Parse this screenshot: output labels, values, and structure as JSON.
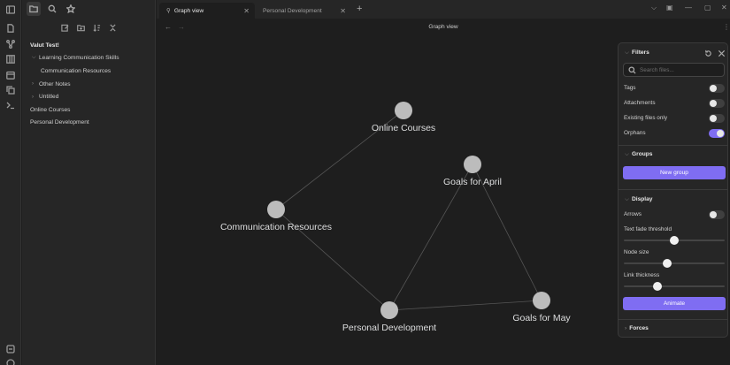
{
  "sidebar": {
    "vault_name": "Valut Test!",
    "tree": [
      {
        "label": "Learning Communication Skills",
        "indent": 1,
        "folder": true
      },
      {
        "label": "Communication Resources",
        "indent": 2,
        "folder": false
      },
      {
        "label": "Other Notes",
        "indent": 1,
        "folder": true
      },
      {
        "label": "Untitled",
        "indent": 1,
        "folder": true
      },
      {
        "label": "Online Courses",
        "indent": 0,
        "folder": false
      },
      {
        "label": "Personal Development",
        "indent": 0,
        "folder": false
      }
    ]
  },
  "tabs": [
    {
      "label": "Graph view",
      "active": true
    },
    {
      "label": "Personal Development",
      "active": false
    }
  ],
  "view": {
    "title": "Graph view"
  },
  "graph": {
    "nodes": [
      {
        "id": "online",
        "label": "Online Courses"
      },
      {
        "id": "april",
        "label": "Goals for April"
      },
      {
        "id": "comm",
        "label": "Communication Resources"
      },
      {
        "id": "personal",
        "label": "Personal Development"
      },
      {
        "id": "may",
        "label": "Goals for May"
      }
    ],
    "edges": [
      [
        "online",
        "comm"
      ],
      [
        "comm",
        "personal"
      ],
      [
        "personal",
        "april"
      ],
      [
        "april",
        "may"
      ],
      [
        "personal",
        "may"
      ]
    ]
  },
  "filters": {
    "title": "Filters",
    "search_placeholder": "Search files...",
    "tags_label": "Tags",
    "tags_on": false,
    "attachments_label": "Attachments",
    "attachments_on": false,
    "existing_label": "Existing files only",
    "existing_on": false,
    "orphans_label": "Orphans",
    "orphans_on": true
  },
  "groups": {
    "title": "Groups",
    "new_group_label": "New group"
  },
  "display": {
    "title": "Display",
    "arrows_label": "Arrows",
    "arrows_on": false,
    "text_fade_label": "Text fade threshold",
    "text_fade_value": 0.5,
    "node_size_label": "Node size",
    "node_size_value": 0.43,
    "link_thickness_label": "Link thickness",
    "link_thickness_value": 0.33,
    "animate_label": "Animate"
  },
  "forces": {
    "title": "Forces"
  },
  "colors": {
    "accent": "#7f6df2",
    "node": "#bcbcbc",
    "edge": "#555555"
  }
}
